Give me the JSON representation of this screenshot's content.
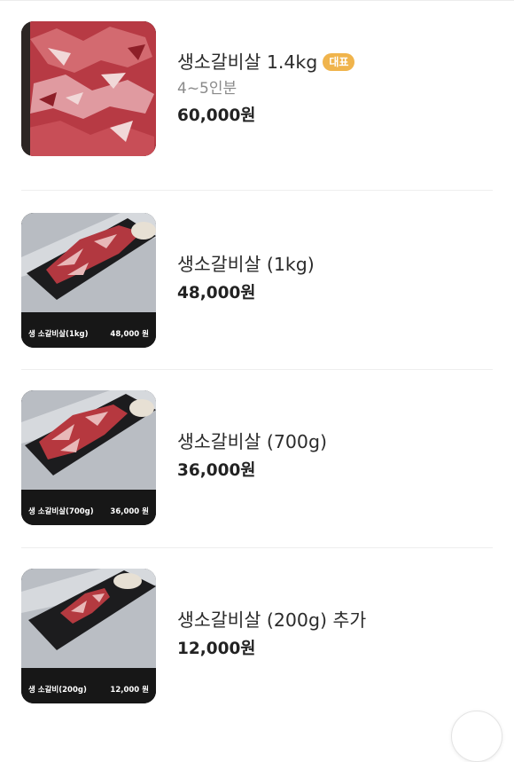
{
  "menu": {
    "items": [
      {
        "name": "생소갈비살 1.4kg",
        "badge": "대표",
        "desc": "4~5인분",
        "price": "60,000원",
        "photo_caption_name": "",
        "photo_caption_price": ""
      },
      {
        "name": "생소갈비살 (1kg)",
        "price": "48,000원",
        "photo_caption_name": "생 소갈비살(1kg)",
        "photo_caption_price": "48,000 원"
      },
      {
        "name": "생소갈비살 (700g)",
        "price": "36,000원",
        "photo_caption_name": "생 소갈비살(700g)",
        "photo_caption_price": "36,000 원"
      },
      {
        "name": "생소갈비살 (200g) 추가",
        "price": "12,000원",
        "photo_caption_name": "생 소갈비(200g)",
        "photo_caption_price": "12,000 원"
      }
    ]
  },
  "colors": {
    "badge": "#f0b44c",
    "price": "#222222",
    "desc": "#8a8a8a",
    "meat": "#b2323a"
  }
}
